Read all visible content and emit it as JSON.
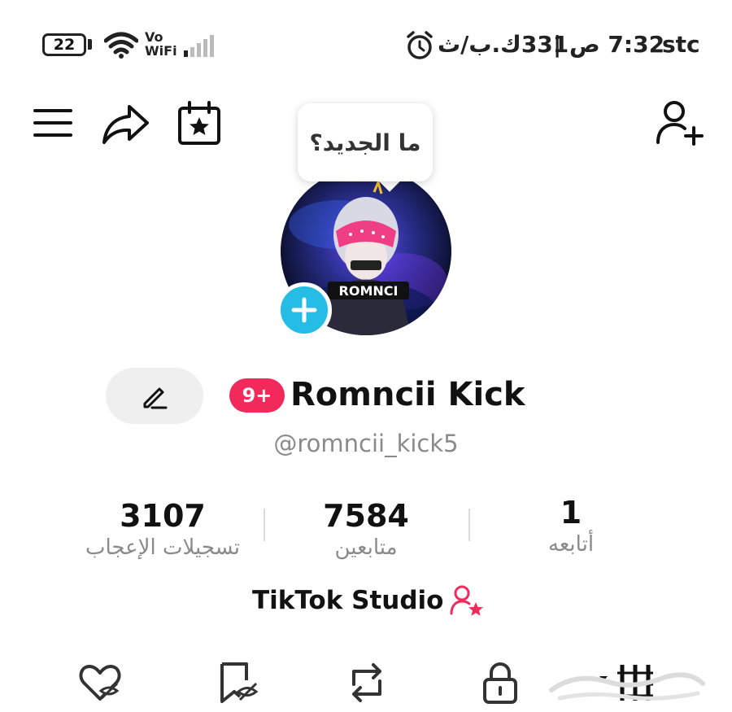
{
  "statusbar": {
    "battery_level": "22",
    "vowifi_vo": "Vo",
    "vowifi_wifi": "WiFi",
    "right_text": "stc 7:32 ص | 331ك.ب/ث",
    "time_text": "7:32 ص",
    "speed_text": "331ك.ب/ث",
    "carrier": "stc",
    "separator": "|"
  },
  "header": {
    "menu_icon": "menu-icon",
    "share_icon": "share-icon",
    "calendar_icon": "calendar-star-icon",
    "add_friend_icon": "add-friend-icon"
  },
  "bubble": {
    "text": "ما الجديد؟"
  },
  "profile": {
    "display_name": "Romncii Kick",
    "notification_badge": "9+",
    "username": "@romncii_kick5",
    "edit_icon": "pencil-icon"
  },
  "stats": [
    {
      "value": "3107",
      "label": "تسجيلات الإعجاب"
    },
    {
      "value": "7584",
      "label": "متابعين"
    },
    {
      "value": "1",
      "label": "أتابعه"
    }
  ],
  "studio": {
    "label": "TikTok Studio",
    "icon": "creator-star-icon",
    "icon_color": "#f2295b"
  },
  "tabs": [
    {
      "icon": "liked-hidden-icon"
    },
    {
      "icon": "favorites-hidden-icon"
    },
    {
      "icon": "repost-icon"
    },
    {
      "icon": "lock-icon"
    },
    {
      "icon": "videos-grid-icon"
    }
  ],
  "colors": {
    "accent_pink": "#f2295b",
    "accent_cyan": "#25bde6"
  }
}
